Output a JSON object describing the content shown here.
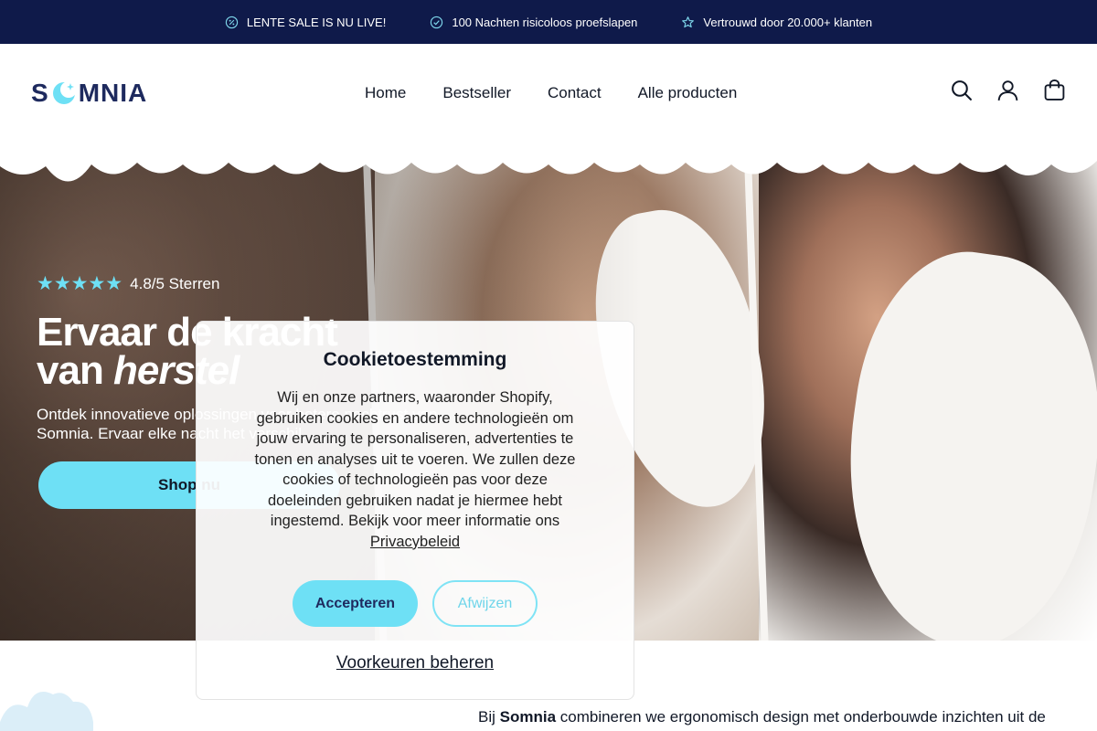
{
  "announcement": {
    "items": [
      {
        "icon": "badge-percent-icon",
        "text": "LENTE SALE IS NU LIVE!"
      },
      {
        "icon": "shield-check-icon",
        "text": "100 Nachten risicoloos proefslapen"
      },
      {
        "icon": "star-outline-icon",
        "text": "Vertrouwd door 20.000+ klanten"
      }
    ]
  },
  "header": {
    "logo_left": "S",
    "logo_right": "MNIA",
    "nav": [
      "Home",
      "Bestseller",
      "Contact",
      "Alle producten"
    ]
  },
  "hero": {
    "stars": "★★★★★",
    "rating_text": "4.8/5 Sterren",
    "title_line1": "Ervaar de kracht",
    "title_line2_prefix": "van ",
    "title_line2_em": "herstel",
    "subtitle_line1": "Ontdek innovatieve oplossingen voor betere nachtrust van",
    "subtitle_line2": "Somnia. Ervaar elke nacht het verschil.",
    "cta": "Shop nu"
  },
  "intro": {
    "prefix": "Bij ",
    "brand": "Somnia",
    "text": " combineren we ergonomisch design met onderbouwde inzichten uit de"
  },
  "cookie": {
    "title": "Cookietoestemming",
    "body": "Wij en onze partners, waaronder Shopify, gebruiken cookies en andere technologieën om jouw ervaring te personaliseren, advertenties te tonen en analyses uit te voeren. We zullen deze cookies of technologieën pas voor deze doeleinden gebruiken nadat je hiermee hebt ingestemd. Bekijk voor meer informatie ons",
    "link": "Privacybeleid",
    "accept": "Accepteren",
    "decline": "Afwijzen",
    "preferences": "Voorkeuren beheren"
  },
  "colors": {
    "announcement_bg": "#0f1a4a",
    "accent": "#6ee0f5",
    "logo": "#1e2a5e"
  }
}
